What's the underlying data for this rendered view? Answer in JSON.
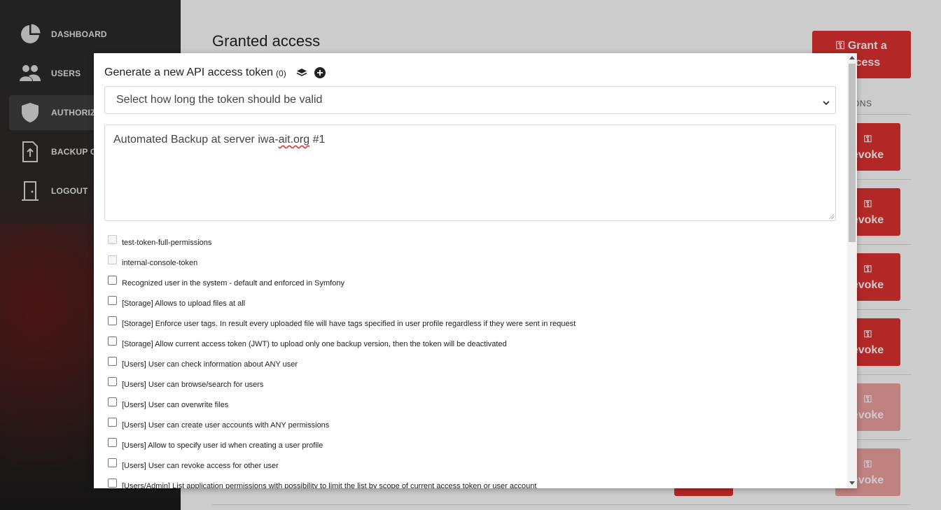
{
  "sidebar": {
    "items": [
      {
        "label": "DASHBOARD",
        "icon": "pie-chart-icon"
      },
      {
        "label": "USERS",
        "icon": "users-icon"
      },
      {
        "label": "AUTHORIZ",
        "icon": "shield-icon",
        "active": true
      },
      {
        "label": "BACKUP C",
        "icon": "file-upload-icon"
      },
      {
        "label": "LOGOUT",
        "icon": "door-icon"
      }
    ]
  },
  "main": {
    "title": "Granted access",
    "grant_button": {
      "line1": "Grant a",
      "line2": "access",
      "icon": "key-icon"
    },
    "actions_header": "ONS",
    "revoke_label": "evoke"
  },
  "modal": {
    "title": "Generate a new API access token",
    "count": "(0)",
    "select_placeholder": "Select how long the token should be valid",
    "description_before": "Automated Backup at server iwa-",
    "description_misspelled": "ait.org",
    "description_after": " #1",
    "permissions": [
      {
        "label": "test-token-full-permissions",
        "disabled": true
      },
      {
        "label": "internal-console-token",
        "disabled": true
      },
      {
        "label": "Recognized user in the system - default and enforced in Symfony",
        "disabled": false
      },
      {
        "label": "[Storage] Allows to upload files at all",
        "disabled": false
      },
      {
        "label": "[Storage] Enforce user tags. In result every uploaded file will have tags specified in user profile regardless if they were sent in request",
        "disabled": false
      },
      {
        "label": "[Storage] Allow current access token (JWT) to upload only one backup version, then the token will be deactivated",
        "disabled": false
      },
      {
        "label": "[Users] User can check information about ANY user",
        "disabled": false
      },
      {
        "label": "[Users] User can browse/search for users",
        "disabled": false
      },
      {
        "label": "[Users] User can overwrite files",
        "disabled": false
      },
      {
        "label": "[Users] User can create user accounts with ANY permissions",
        "disabled": false
      },
      {
        "label": "[Users] Allow to specify user id when creating a user profile",
        "disabled": false
      },
      {
        "label": "[Users] User can revoke access for other user",
        "disabled": false
      },
      {
        "label": "[Users/Admin] List application permissions with possibility to limit the list by scope of current access token or user account",
        "disabled": false
      }
    ]
  },
  "colors": {
    "accent": "#e03131",
    "sidebar_bg": "#2b2b2b",
    "overlay": "rgba(0,0,0,0.2)"
  }
}
